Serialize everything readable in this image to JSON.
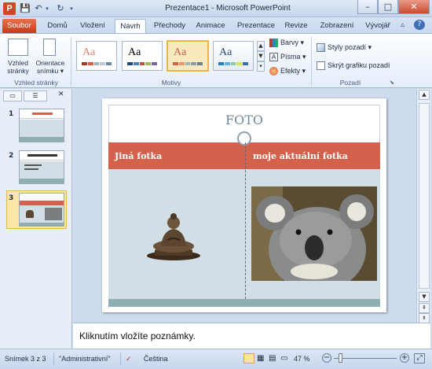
{
  "window": {
    "title": "Prezentace1  -  Microsoft PowerPoint",
    "min": "–",
    "max": "□",
    "close": "✕"
  },
  "qat": {
    "save": "💾",
    "undo": "↶",
    "redo": "↻",
    "customize": "▾"
  },
  "tabs": [
    {
      "label": "Soubor"
    },
    {
      "label": "Domů"
    },
    {
      "label": "Vložení"
    },
    {
      "label": "Návrh"
    },
    {
      "label": "Přechody"
    },
    {
      "label": "Animace"
    },
    {
      "label": "Prezentace"
    },
    {
      "label": "Revize"
    },
    {
      "label": "Zobrazení"
    },
    {
      "label": "Vývojář"
    }
  ],
  "ribbon": {
    "page_setup": {
      "group": "Vzhled stránky",
      "setup_label": "Vzhled stránky",
      "orient_label": "Orientace snímku ▾"
    },
    "themes": {
      "group": "Motivy",
      "tile_text": "Aa"
    },
    "theme_options": {
      "colors": "Barvy ▾",
      "fonts": "Písma ▾",
      "effects": "Efekty ▾"
    },
    "background": {
      "group": "Pozadí",
      "styles": "Styly pozadí ▾",
      "hide_graphics": "Skrýt grafiku pozadí"
    }
  },
  "slides_panel": {
    "numbers": [
      "1",
      "2",
      "3"
    ]
  },
  "slide": {
    "title": "FOTO",
    "left_heading": "Jiná fotka",
    "right_heading": "moje aktuální fotka"
  },
  "notes": {
    "placeholder": "Kliknutím vložíte poznámky."
  },
  "status": {
    "slide": "Snímek 3 z 3",
    "theme": "\"Administrativní\"",
    "language": "Čeština",
    "zoom": "47 %"
  },
  "colors": {
    "accent": "#d3614b",
    "file_tab": "#c33b17",
    "selected_theme": "#e8b54a"
  }
}
